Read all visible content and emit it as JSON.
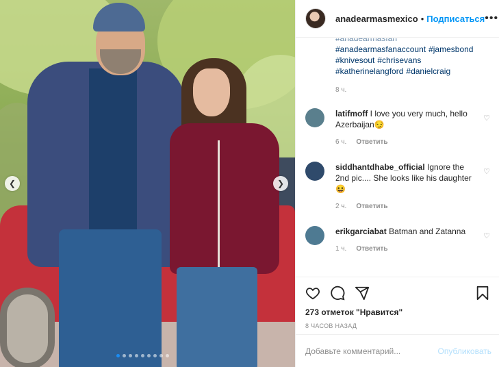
{
  "post": {
    "username": "anadearmasmexico",
    "separator": "•",
    "follow_label": "Подписаться",
    "more_icon": "more-dots-icon"
  },
  "caption": {
    "truncated_line": "#anadearmasfan",
    "hashtags": [
      "#anadearmasfanaccount",
      "#jamesbond",
      "#knivesout",
      "#chrisevans",
      "#katherinelangford",
      "#danielcraig"
    ],
    "time": "8 ч."
  },
  "comments": [
    {
      "user": "latifmoff",
      "text": "I love you very much, hello Azerbaijan",
      "emoji": "😏",
      "time": "6 ч.",
      "reply": "Ответить",
      "avatar_color": "#5a7f8d"
    },
    {
      "user": "siddhantdhabe_official",
      "text": "Ignore the 2nd pic.... She looks like his daughter",
      "emoji": "😆",
      "time": "2 ч.",
      "reply": "Ответить",
      "avatar_color": "#2f4a6b"
    },
    {
      "user": "erikgarciabat",
      "text": "Batman and Zatanna",
      "emoji": "",
      "time": "1 ч.",
      "reply": "Ответить",
      "avatar_color": "#4e7a92"
    }
  ],
  "actions": {
    "likes": "273 отметок \"Нравится\"",
    "posted_ago": "8 ЧАСОВ НАЗАД"
  },
  "add_comment": {
    "placeholder": "Добавьте комментарий...",
    "publish_label": "Опубликовать"
  },
  "carousel": {
    "prev_icon": "chevron-left-icon",
    "next_icon": "chevron-right-icon",
    "dot_count": 9,
    "active_dot": 0
  },
  "colors": {
    "link_blue": "#0095f6",
    "hashtag_blue": "#00376b",
    "muted": "#8e8e8e"
  }
}
